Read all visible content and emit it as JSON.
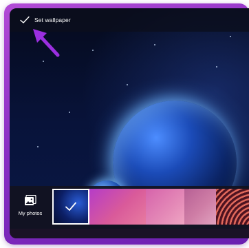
{
  "toolbar": {
    "set_wallpaper_label": "Set wallpaper",
    "check_icon": "check-icon"
  },
  "annotation": {
    "arrow_icon": "arrow-up-left-icon",
    "arrow_color": "#9b2fe0"
  },
  "wallpaper": {
    "selected_index": 0
  },
  "picker": {
    "my_photos_label": "My photos",
    "photo_icon": "photo-icon",
    "thumbnails": [
      {
        "name": "space-planet",
        "selected": true
      },
      {
        "name": "magenta-gradient",
        "selected": false
      },
      {
        "name": "pink-gradient",
        "selected": false
      },
      {
        "name": "rose-gradient",
        "selected": false
      },
      {
        "name": "orange-waves",
        "selected": false
      }
    ]
  },
  "colors": {
    "frame": "#8a2fc4",
    "topbar": "#0c0e1c",
    "text": "#ffffff"
  }
}
